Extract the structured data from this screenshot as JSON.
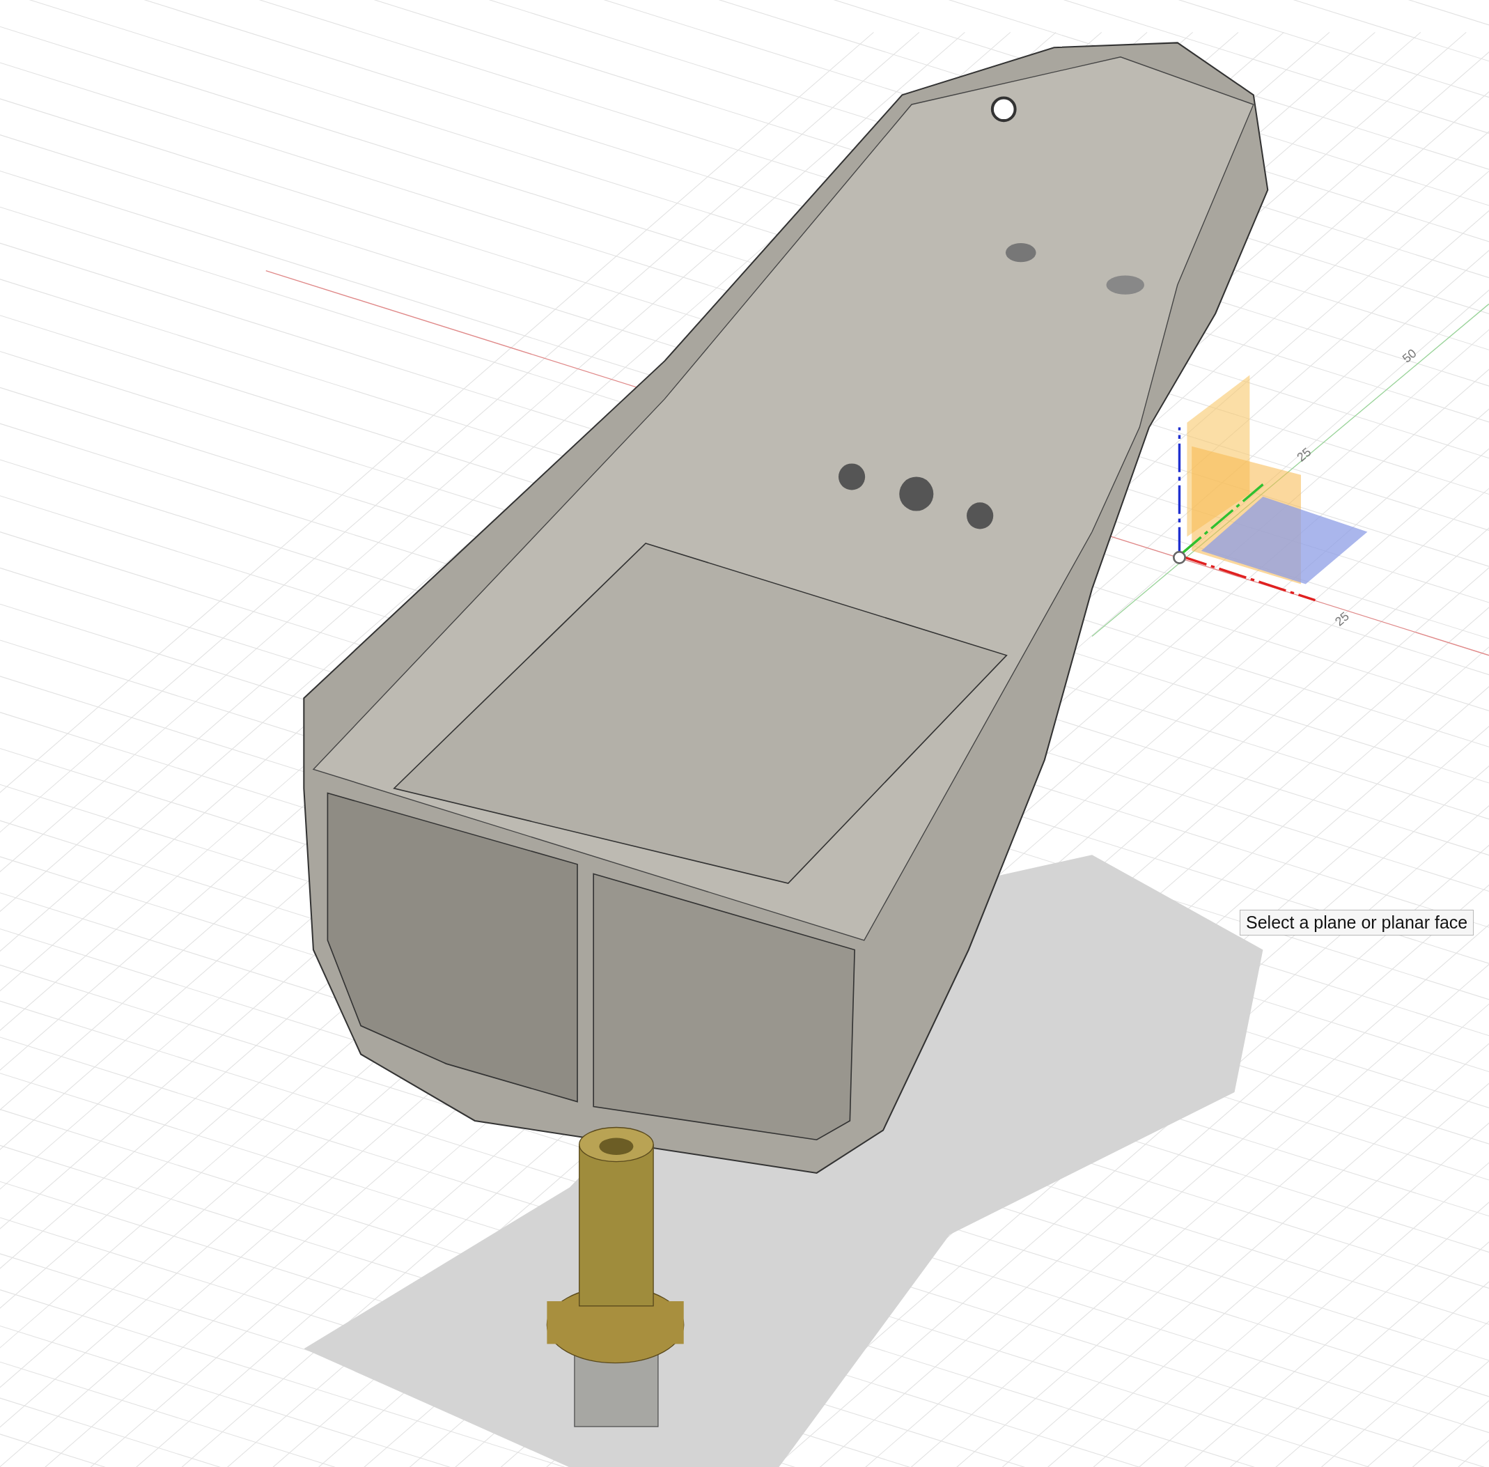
{
  "viewport": {
    "axis_labels": [
      {
        "text": "50"
      },
      {
        "text": "25"
      },
      {
        "text": "25"
      }
    ]
  },
  "tooltip": {
    "text": "Select a plane or planar face"
  }
}
